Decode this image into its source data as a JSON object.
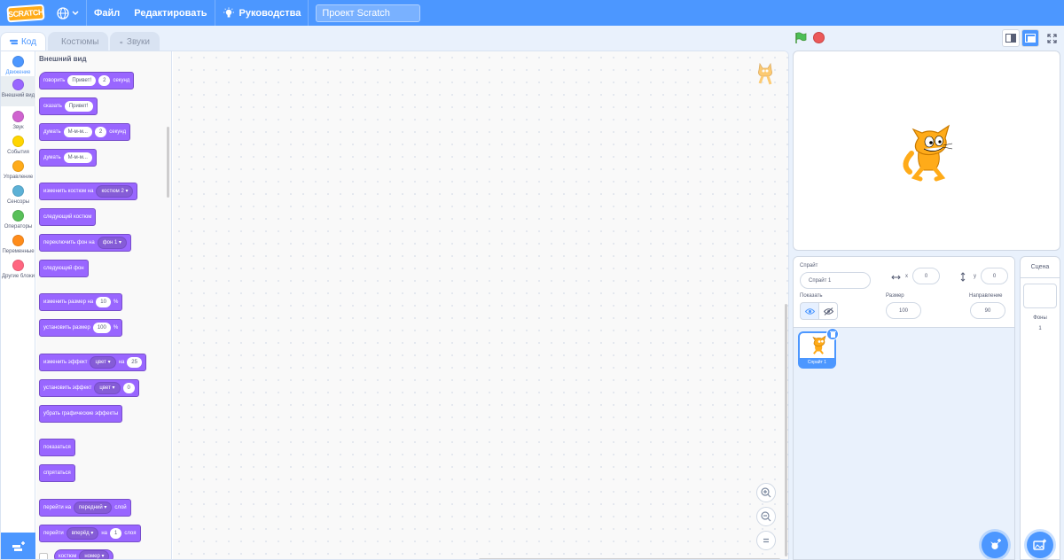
{
  "menu": {
    "logo": "SCRATCH",
    "file": "Файл",
    "edit": "Редактировать",
    "tutorials": "Руководства",
    "project_title": "Проект Scratch"
  },
  "tabs": {
    "code": "Код",
    "costumes": "Костюмы",
    "sounds": "Звуки"
  },
  "categories": [
    {
      "label": "Движение",
      "color": "#4c97ff"
    },
    {
      "label": "Внешний вид",
      "color": "#9966ff"
    },
    {
      "label": "Звук",
      "color": "#cf63cf"
    },
    {
      "label": "События",
      "color": "#ffd500"
    },
    {
      "label": "Управление",
      "color": "#ffab19"
    },
    {
      "label": "Сенсоры",
      "color": "#5cb1d6"
    },
    {
      "label": "Операторы",
      "color": "#59c059"
    },
    {
      "label": "Переменные",
      "color": "#ff8c1a"
    },
    {
      "label": "Другие блоки",
      "color": "#ff6680"
    }
  ],
  "flyout": {
    "title": "Внешний вид",
    "b1": {
      "t1": "говорить",
      "v1": "Привет!",
      "v2": "2",
      "t2": "секунд"
    },
    "b2": {
      "t1": "сказать",
      "v1": "Привет!"
    },
    "b3": {
      "t1": "думать",
      "v1": "М-м-м...",
      "v2": "2",
      "t2": "секунд"
    },
    "b4": {
      "t1": "думать",
      "v1": "М-м-м..."
    },
    "b5": {
      "t1": "изменить костюм на",
      "d1": "костюм 2"
    },
    "b6": {
      "t1": "следующий костюм"
    },
    "b7": {
      "t1": "переключить фон на",
      "d1": "фон 1"
    },
    "b8": {
      "t1": "следующий фон"
    },
    "b9": {
      "t1": "изменить размер на",
      "v1": "10",
      "t2": "%"
    },
    "b10": {
      "t1": "установить размер",
      "v1": "100",
      "t2": "%"
    },
    "b11": {
      "t1": "изменить эффект",
      "d1": "цвет",
      "t2": "на",
      "v1": "25"
    },
    "b12": {
      "t1": "установить эффект",
      "d1": "цвет",
      "v1": "0"
    },
    "b13": {
      "t1": "убрать графические эффекты"
    },
    "b14": {
      "t1": "показаться"
    },
    "b15": {
      "t1": "спрятаться"
    },
    "b16": {
      "t1": "перейти на",
      "d1": "передний",
      "t2": "слой"
    },
    "b17": {
      "t1": "перейти",
      "d1": "вперёд",
      "t2": "на",
      "v1": "1",
      "t3": "слоя"
    },
    "b18": {
      "t1": "костюм",
      "d1": "номер"
    }
  },
  "sprite_info": {
    "sprite_label": "Спрайт",
    "sprite_name": "Спрайт 1",
    "x_label": "x",
    "x_value": "0",
    "y_label": "y",
    "y_value": "0",
    "show_label": "Показать",
    "size_label": "Размер",
    "size_value": "100",
    "direction_label": "Направление",
    "direction_value": "90"
  },
  "sprite_list": [
    {
      "name": "Спрайт 1"
    }
  ],
  "stage_pane": {
    "title": "Сцена",
    "backdrops_label": "Фоны",
    "backdrops_count": "1"
  }
}
